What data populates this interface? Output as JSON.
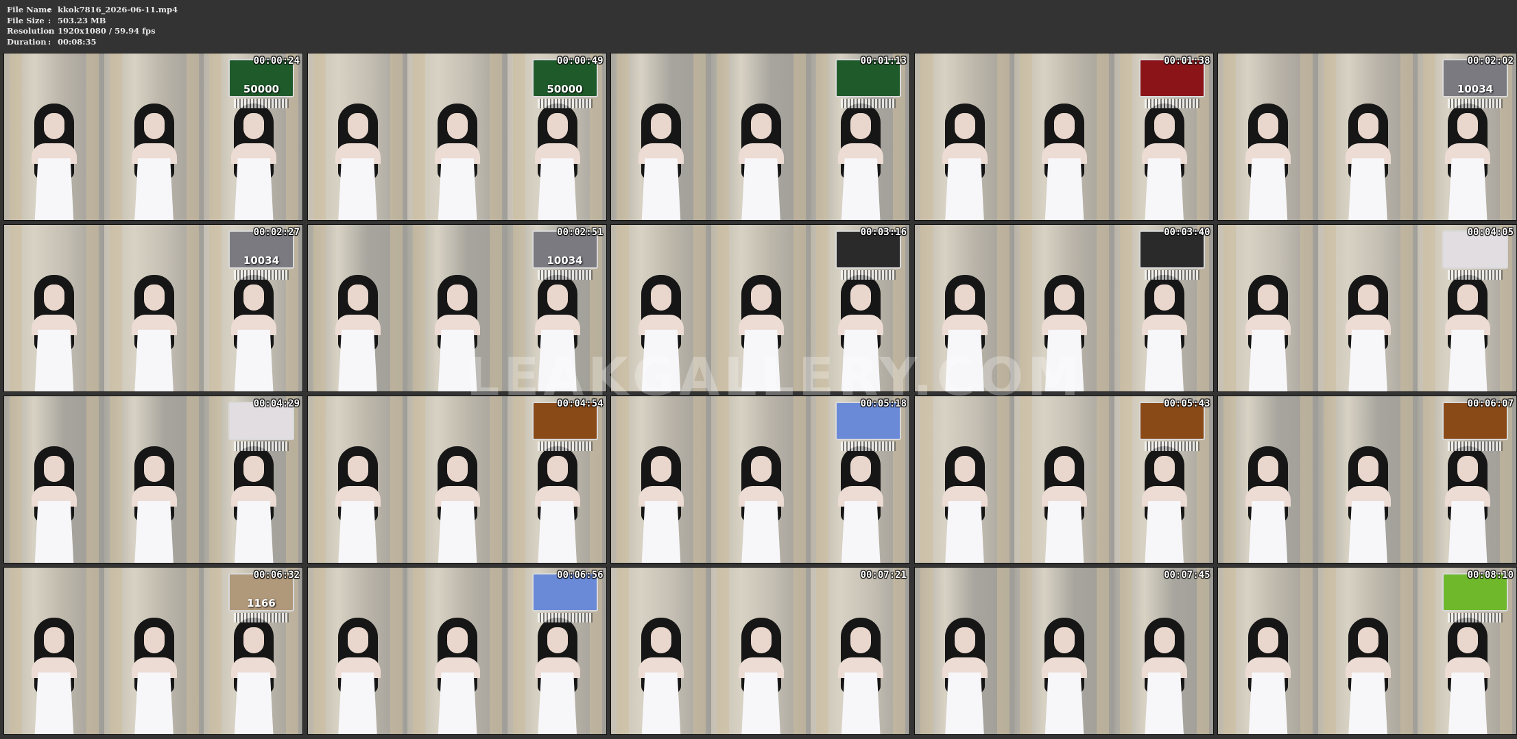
{
  "metadata": {
    "file_name_label": "File Name",
    "file_name": "kkok7816_2026-06-11.mp4",
    "file_size_label": "File Size",
    "file_size": "503.23 MB",
    "resolution_label": "Resolution",
    "resolution": "1920x1080 / 59.94 fps",
    "duration_label": "Duration",
    "duration": "00:08:35",
    "separator": ":"
  },
  "frames": [
    {
      "time": "00:00:24",
      "overlay": "green",
      "overlay_text": "50000"
    },
    {
      "time": "00:00:49",
      "overlay": "green",
      "overlay_text": "50000"
    },
    {
      "time": "00:01:13",
      "overlay": "green",
      "overlay_text": ""
    },
    {
      "time": "00:01:38",
      "overlay": "red",
      "overlay_text": ""
    },
    {
      "time": "00:02:02",
      "overlay": "gray",
      "overlay_text": "10034"
    },
    {
      "time": "00:02:27",
      "overlay": "gray",
      "overlay_text": "10034"
    },
    {
      "time": "00:02:51",
      "overlay": "gray",
      "overlay_text": "10034"
    },
    {
      "time": "00:03:16",
      "overlay": "dark",
      "overlay_text": ""
    },
    {
      "time": "00:03:40",
      "overlay": "dark",
      "overlay_text": ""
    },
    {
      "time": "00:04:05",
      "overlay": "balloon",
      "overlay_text": ""
    },
    {
      "time": "00:04:29",
      "overlay": "balloon",
      "overlay_text": ""
    },
    {
      "time": "00:04:54",
      "overlay": "orange",
      "overlay_text": ""
    },
    {
      "time": "00:05:18",
      "overlay": "blue",
      "overlay_text": ""
    },
    {
      "time": "00:05:43",
      "overlay": "orange",
      "overlay_text": ""
    },
    {
      "time": "00:06:07",
      "overlay": "orange",
      "overlay_text": ""
    },
    {
      "time": "00:06:32",
      "overlay": "portrait",
      "overlay_text": "1166"
    },
    {
      "time": "00:06:56",
      "overlay": "blue",
      "overlay_text": ""
    },
    {
      "time": "00:07:21",
      "overlay": "none",
      "overlay_text": ""
    },
    {
      "time": "00:07:45",
      "overlay": "none",
      "overlay_text": ""
    },
    {
      "time": "00:08:10",
      "overlay": "lime",
      "overlay_text": ""
    }
  ],
  "overlay_colors": {
    "green": "#1f5a2a",
    "red": "#8a1418",
    "gray": "#7a7a80",
    "dark": "#2a2a2a",
    "balloon": "#e2dde0",
    "orange": "#8a4a18",
    "blue": "#6a8ad8",
    "portrait": "#b0987a",
    "lime": "#6fb82c"
  },
  "watermark": "LEAKGALLERY.COM",
  "wall_colors": [
    "#b9b3a8",
    "#c6c0b4",
    "#a7a59d",
    "#bdb7aa"
  ]
}
